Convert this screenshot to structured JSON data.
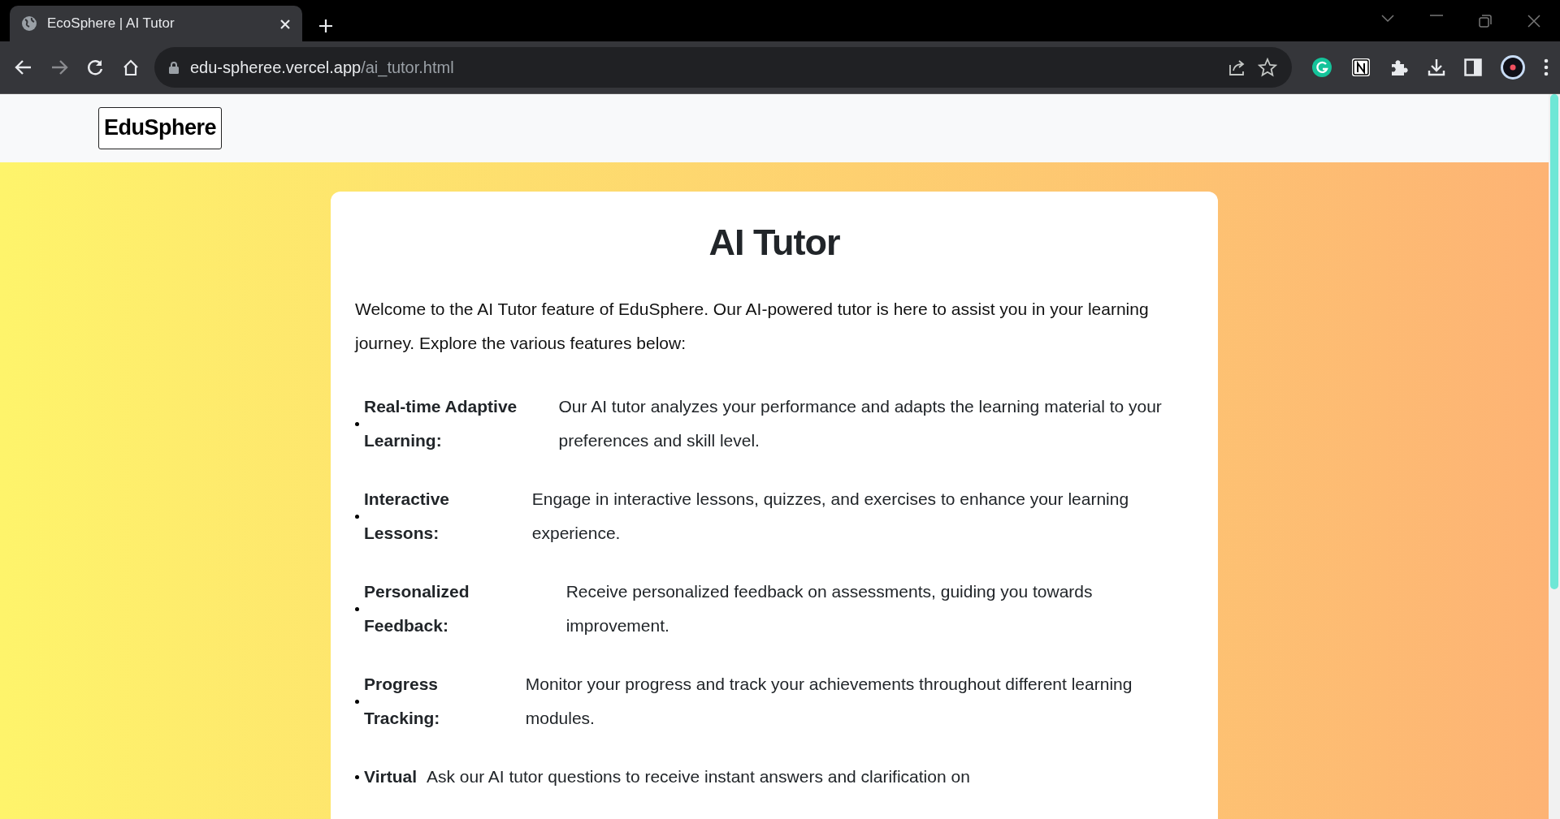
{
  "browser": {
    "tab": {
      "title": "EcoSphere | AI Tutor"
    },
    "address": {
      "domain": "edu-spheree.vercel.app",
      "path": "/ai_tutor.html"
    }
  },
  "navbar": {
    "brand": "EduSphere"
  },
  "content": {
    "title": "AI Tutor",
    "intro": "Welcome to the AI Tutor feature of EduSphere. Our AI-powered tutor is here to assist you in your learning journey. Explore the various features below:",
    "features": [
      {
        "term": "Real-time Adaptive Learning:",
        "description": "Our AI tutor analyzes your performance and adapts the learning material to your preferences and skill level."
      },
      {
        "term": "Interactive Lessons:",
        "description": "Engage in interactive lessons, quizzes, and exercises to enhance your learning experience."
      },
      {
        "term": "Personalized Feedback:",
        "description": "Receive personalized feedback on assessments, guiding you towards improvement."
      },
      {
        "term": "Progress Tracking:",
        "description": "Monitor your progress and track your achievements throughout different learning modules."
      },
      {
        "term": "Virtual",
        "description": "Ask our AI tutor questions to receive instant answers and clarification on"
      }
    ]
  }
}
